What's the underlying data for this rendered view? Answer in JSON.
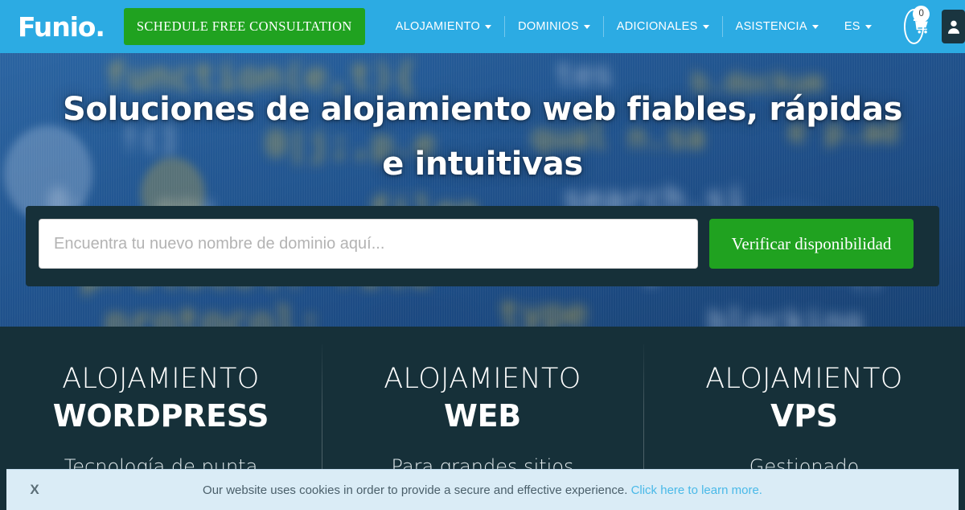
{
  "brand": {
    "logo_text": "Funio.",
    "nav_bg": "#2cabe3",
    "accent_green": "#20a220",
    "dark_teal": "#163039"
  },
  "navbar": {
    "cta_label": "SCHEDULE FREE CONSULTATION",
    "items": [
      {
        "label": "ALOJAMIENTO",
        "has_caret": true
      },
      {
        "label": "DOMINIOS",
        "has_caret": true
      },
      {
        "label": "ADICIONALES",
        "has_caret": true
      },
      {
        "label": "ASISTENCIA",
        "has_caret": true
      },
      {
        "label": "ES",
        "has_caret": true
      }
    ],
    "cart": {
      "icon": "shopping-cart-icon",
      "count": "0"
    },
    "account": {
      "icon": "user-icon"
    }
  },
  "hero": {
    "title": "Soluciones de alojamiento web fiables, rápidas e intuitivas",
    "search": {
      "placeholder": "Encuentra tu nuevo nombre de dominio aquí...",
      "value": "",
      "button_label": "Verificar disponibilidad"
    }
  },
  "features": [
    {
      "kicker": "ALOJAMIENTO",
      "title": "WORDPRESS",
      "subtitle": "Tecnología de punta"
    },
    {
      "kicker": "ALOJAMIENTO",
      "title": "WEB",
      "subtitle": "Para grandes sitios"
    },
    {
      "kicker": "ALOJAMIENTO",
      "title": "VPS",
      "subtitle": "Gestionado"
    }
  ],
  "cookie_bar": {
    "close_label": "X",
    "message": "Our website uses cookies in order to provide a secure and effective experience.",
    "link_label": "Click here to learn more."
  }
}
